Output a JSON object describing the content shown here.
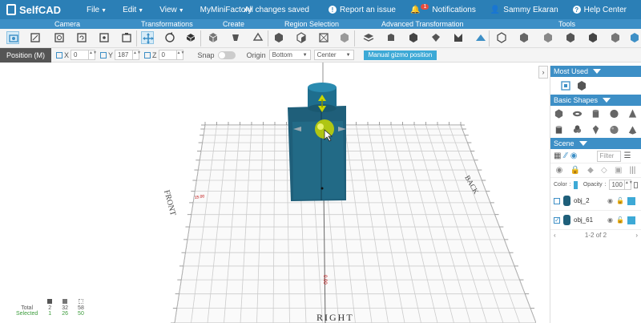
{
  "app": {
    "name": "SelfCAD"
  },
  "menu": {
    "file": "File",
    "edit": "Edit",
    "view": "View",
    "myminifactory": "MyMiniFactory"
  },
  "status": {
    "saved": "All changes saved",
    "report": "Report an issue",
    "notifications": "Notifications",
    "notif_count": "1",
    "user": "Sammy Ekaran",
    "help": "Help Center"
  },
  "categories": {
    "camera": "Camera",
    "transformations": "Transformations",
    "create": "Create",
    "region": "Region Selection",
    "advanced": "Advanced Transformation",
    "tools": "Tools"
  },
  "posbar": {
    "mode": "Position (M)",
    "x_label": "X",
    "x_value": "0",
    "y_label": "Y",
    "y_value": "187",
    "z_label": "Z",
    "z_value": "0",
    "snap": "Snap",
    "origin": "Origin",
    "origin_value": "Bottom",
    "center_value": "Center",
    "gizmo": "Manual gizmo position"
  },
  "viewport": {
    "front": "FRONT",
    "back": "BACK",
    "right": "RIGHT",
    "coord_left": "15.00",
    "coord_bottom": "0.00"
  },
  "stats": {
    "total_label": "Total",
    "selected_label": "Selected",
    "total": [
      "2",
      "32",
      "58"
    ],
    "selected": [
      "1",
      "26",
      "50"
    ]
  },
  "panel": {
    "most_used": "Most Used",
    "basic_shapes": "Basic Shapes",
    "scene": "Scene",
    "filter": "Filter",
    "color": "Color",
    "opacity": "Opacity",
    "opacity_value": "100",
    "pages": "1-2 of 2"
  },
  "objects": [
    {
      "name": "obj_2",
      "checked": false
    },
    {
      "name": "obj_61",
      "checked": true
    }
  ],
  "colors": {
    "primary": "#2b7fb6",
    "object": "#1f5f7a",
    "accent": "#3da9d6",
    "gizmo": "#c8d600"
  }
}
